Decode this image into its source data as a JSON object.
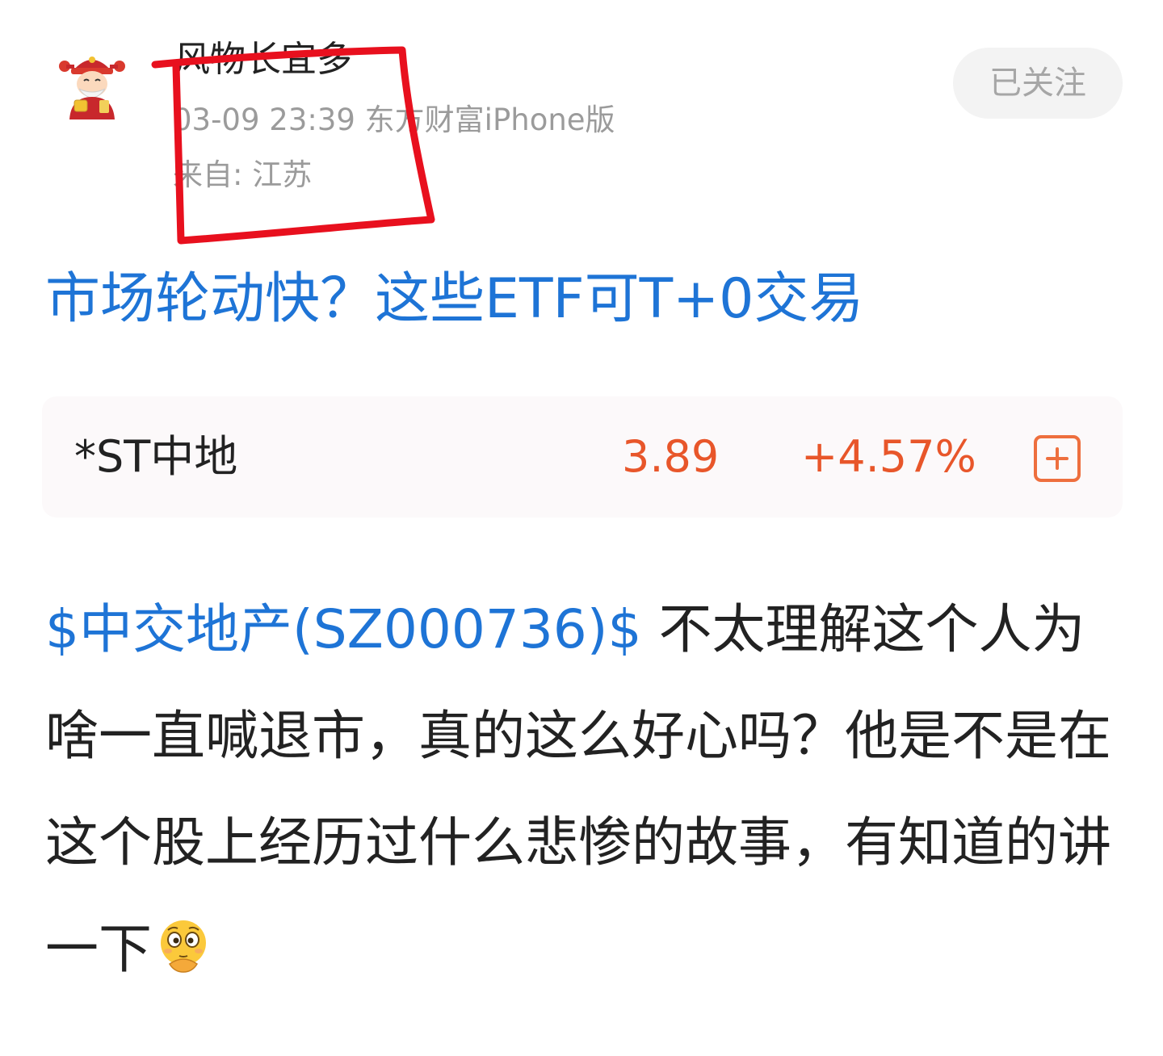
{
  "author": {
    "name": "风物长宜多",
    "time_source": "03-09 23:39 东方财富iPhone版",
    "location": "来自: 江苏",
    "avatar_icon": "caishen-avatar-icon"
  },
  "follow_button": {
    "label": "已关注"
  },
  "post": {
    "title": "市场轮动快？这些ETF可T+0交易",
    "stock_tag": "$中交地产(SZ000736)$",
    "body_text": " 不太理解这个人为啥一直喊退市，真的这么好心吗？他是不是在这个股上经历过什么悲惨的故事，有知道的讲一下",
    "emoji_icon": "flushed-hand-on-chin-emoji"
  },
  "stock_card": {
    "name": "*ST中地",
    "price": "3.89",
    "change": "+4.57%",
    "add_icon": "plus-square-icon"
  },
  "colors": {
    "link_blue": "#1e74d6",
    "up_red": "#e8562a",
    "annotation_red": "#e8101e",
    "meta_gray": "#9b9b9b"
  }
}
